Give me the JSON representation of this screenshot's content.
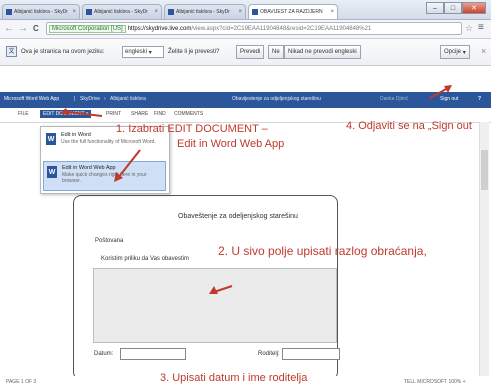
{
  "browser": {
    "tabs": [
      {
        "title": "Albijanić tisklora - SkyDr"
      },
      {
        "title": "Albijanić tisklora - SkyDr"
      },
      {
        "title": "Albijanić tisklora - SkyDr"
      },
      {
        "title": "OBAVIJEST ZA RAZDJERN"
      }
    ],
    "window_controls": {
      "minimize": "–",
      "maximize": "□",
      "close": "✕"
    },
    "nav": {
      "back": "←",
      "forward": "→",
      "reload": "C"
    },
    "address": {
      "secure_label": "Microsoft Corporation [US]",
      "domain": "https://skydrive.live.com",
      "path": "/view.aspx?cid=2C19EAA11904848&resid=2C19EAA11904848%21"
    },
    "menu_icon": "≡",
    "star_icon": "☆"
  },
  "translate_bar": {
    "prompt": "Ova je stranica na ovom jeziku:",
    "source_language": "engleski",
    "question": "Želite li je prevesti?",
    "translate_button": "Prevedi",
    "no_button": "Ne",
    "never_button": "Nikad ne prevodi engleski",
    "options_button": "Opcije",
    "close": "×"
  },
  "office": {
    "app": "Microsoft Word Web App",
    "breadcrumb_sep": "|",
    "service": "SkyDrive",
    "breadcrumb_arrow": "›",
    "folder": "Albijanić tisklora",
    "doc_title": "Obavijestenje za odjeljenjskog starešinu",
    "user": "Danka Djinić",
    "sign_out": "Sign out",
    "help": "?"
  },
  "ribbon": {
    "tabs": [
      "FILE",
      "EDIT DOCUMENT ▾",
      "PRINT",
      "SHARE",
      "FIND",
      "COMMENTS"
    ]
  },
  "dropdown": {
    "options": [
      {
        "title": "Edit in Word",
        "desc": "Use the full functionality of Microsoft Word."
      },
      {
        "title": "Edit in Word Web App",
        "desc": "Make quick changes right here in your browser."
      }
    ]
  },
  "document": {
    "heading": "Obaveštenje za odeljenjskog starešinu",
    "greeting": "Poštovana",
    "body": "Koristim priliku da Vas obavestim",
    "date_label": "Datum:",
    "parent_label": "Roditelj:"
  },
  "annotations": {
    "step1_line1": "1.   Izabrati  EDIT DOCUMENT –",
    "step1_line2": "Edit in Word Web App",
    "step2": "2. U sivo polje upisati razlog obraćanja,",
    "step3": "3. Upisati datum i ime roditelja",
    "step4": "4. Odjaviti se  na „Sign out"
  },
  "status": {
    "page": "PAGE 1 OF 3",
    "right": "TELL MICROSOFT   100% +"
  },
  "colors": {
    "office_blue": "#2b579a",
    "annotation_red": "#c0392b"
  }
}
